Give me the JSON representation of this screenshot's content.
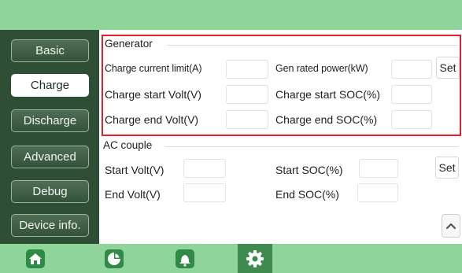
{
  "sidebar": {
    "items": [
      {
        "label": "Basic"
      },
      {
        "label": "Charge"
      },
      {
        "label": "Discharge"
      },
      {
        "label": "Advanced"
      },
      {
        "label": "Debug"
      },
      {
        "label": "Device info."
      }
    ],
    "active": "Charge"
  },
  "generator": {
    "title": "Generator",
    "charge_current_limit": {
      "label": "Charge current limit(A)",
      "value": ""
    },
    "gen_rated_power": {
      "label": "Gen rated power(kW)",
      "value": ""
    },
    "charge_start_volt": {
      "label": "Charge start Volt(V)",
      "value": ""
    },
    "charge_start_soc": {
      "label": "Charge start SOC(%)",
      "value": ""
    },
    "charge_end_volt": {
      "label": "Charge end Volt(V)",
      "value": ""
    },
    "charge_end_soc": {
      "label": "Charge end SOC(%)",
      "value": ""
    },
    "set_label": "Set"
  },
  "ac_couple": {
    "title": "AC couple",
    "start_volt": {
      "label": "Start Volt(V)",
      "value": ""
    },
    "start_soc": {
      "label": "Start SOC(%)",
      "value": ""
    },
    "end_volt": {
      "label": "End Volt(V)",
      "value": ""
    },
    "end_soc": {
      "label": "End SOC(%)",
      "value": ""
    },
    "set_label": "Set"
  },
  "bottom_nav": [
    {
      "icon": "home-icon"
    },
    {
      "icon": "pie-chart-icon"
    },
    {
      "icon": "bell-icon"
    },
    {
      "icon": "gear-icon",
      "active": true
    }
  ],
  "colors": {
    "top_bar": "#8fd49a",
    "sidebar": "#2e4e35",
    "highlight_border": "#e2202b",
    "active_nav": "#3f8b4f"
  }
}
